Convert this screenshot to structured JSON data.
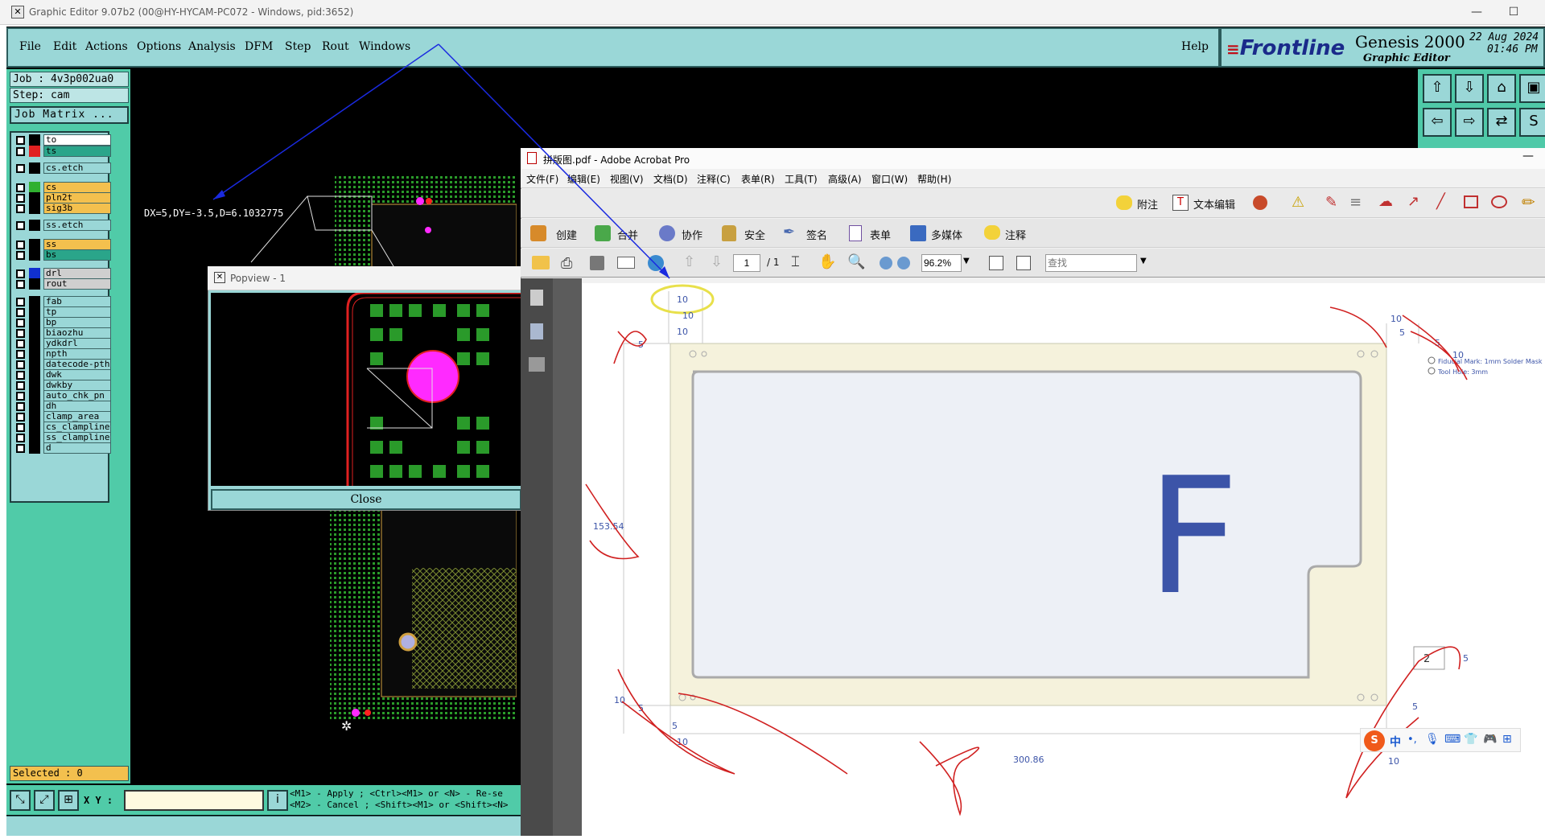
{
  "window": {
    "title": "Graphic Editor 9.07b2 (00@HY-HYCAM-PC072 - Windows, pid:3652)",
    "controls": [
      "minimize",
      "maximize",
      "close"
    ]
  },
  "genesis": {
    "menu": [
      "File",
      "Edit",
      "Actions",
      "Options",
      "Analysis",
      "DFM",
      "Step",
      "Rout",
      "Windows"
    ],
    "help": "Help",
    "brand": {
      "logo": "Frontline",
      "product": "Genesis 2000",
      "subtitle": "Graphic Editor",
      "date": "22 Aug 2024",
      "time": "01:46 PM"
    },
    "job": "Job : 4v3p002ua0",
    "step": "Step: cam",
    "job_matrix": "Job Matrix ...",
    "layers": [
      {
        "name": "to",
        "color": "#000000",
        "bg": "#ffffff"
      },
      {
        "name": "ts",
        "color": "#e02020",
        "bg": "#2aa58a"
      },
      {
        "name": "cs.etch",
        "color": "#000000",
        "bg": "#9ad7d7"
      },
      {
        "name": "cs",
        "color": "#30b030",
        "bg": "#f3c04e"
      },
      {
        "name": "pln2t",
        "color": "#000000",
        "bg": "#f3c04e"
      },
      {
        "name": "sig3b",
        "color": "#000000",
        "bg": "#f3c04e"
      },
      {
        "name": "ss.etch",
        "color": "#000000",
        "bg": "#9ad7d7"
      },
      {
        "name": "ss",
        "color": "#000000",
        "bg": "#f3c04e"
      },
      {
        "name": "bs",
        "color": "#000000",
        "bg": "#2aa58a"
      },
      {
        "name": "drl",
        "color": "#1030d0",
        "bg": "#cfcfcf"
      },
      {
        "name": "rout",
        "color": "#000000",
        "bg": "#cfcfcf"
      },
      {
        "name": "fab",
        "color": "#000000",
        "bg": "#9ad7d7"
      },
      {
        "name": "tp",
        "color": "#000000",
        "bg": "#9ad7d7"
      },
      {
        "name": "bp",
        "color": "#000000",
        "bg": "#9ad7d7"
      },
      {
        "name": "biaozhu",
        "color": "#000000",
        "bg": "#9ad7d7"
      },
      {
        "name": "ydkdrl",
        "color": "#000000",
        "bg": "#9ad7d7"
      },
      {
        "name": "npth",
        "color": "#000000",
        "bg": "#9ad7d7"
      },
      {
        "name": "datecode-pth",
        "color": "#000000",
        "bg": "#9ad7d7"
      },
      {
        "name": "dwk",
        "color": "#000000",
        "bg": "#9ad7d7"
      },
      {
        "name": "dwkby",
        "color": "#000000",
        "bg": "#9ad7d7"
      },
      {
        "name": "auto_chk_pn",
        "color": "#000000",
        "bg": "#9ad7d7"
      },
      {
        "name": "dh",
        "color": "#000000",
        "bg": "#9ad7d7"
      },
      {
        "name": "clamp_area",
        "color": "#000000",
        "bg": "#9ad7d7"
      },
      {
        "name": "cs_clampline",
        "color": "#000000",
        "bg": "#9ad7d7"
      },
      {
        "name": "ss_clampline",
        "color": "#000000",
        "bg": "#9ad7d7"
      },
      {
        "name": "d",
        "color": "#000000",
        "bg": "#9ad7d7"
      }
    ],
    "measure": "DX=5,DY=-3.5,D=6.1032775",
    "popview": {
      "title": "Popview - 1",
      "close": "Close"
    },
    "selected": "Selected : 0",
    "xy_label": "X Y :",
    "xy_value": "",
    "hint1": "<M1> - Apply  ; <Ctrl><M1> or <N> - Re-se",
    "hint2": "<M2> - Cancel ; <Shift><M1> or <Shift><N>"
  },
  "acrobat": {
    "title": "拼版图.pdf - Adobe Acrobat Pro",
    "menu": [
      "文件(F)",
      "编辑(E)",
      "视图(V)",
      "文档(D)",
      "注释(C)",
      "表单(R)",
      "工具(T)",
      "高级(A)",
      "窗口(W)",
      "帮助(H)"
    ],
    "note": "附注",
    "text_edit": "文本编辑",
    "tasks": [
      "创建",
      "合并",
      "协作",
      "安全",
      "签名",
      "表单",
      "多媒体",
      "注释"
    ],
    "page_current": "1",
    "page_total": "/ 1",
    "zoom": "96.2%",
    "search_placeholder": "查找"
  },
  "drawing": {
    "dims": {
      "top_10a": "10",
      "top_10b": "10",
      "top_10c": "10",
      "left_5": "5",
      "right_10": "10",
      "right_5a": "5",
      "right_5b": "5",
      "right_10b": "10",
      "height": "153.54",
      "width": "300.86",
      "bl_10": "10",
      "bl_5": "5",
      "bl_5b": "5",
      "bl_10b": "10",
      "br_5": "5",
      "br_10": "10",
      "detail_2": "2",
      "detail_5": "5"
    },
    "legend": {
      "fiducial": "Fiducial Mark: 1mm  Solder Mask",
      "tool": "Tool Hole: 3mm"
    },
    "letter": "F"
  },
  "ime": {
    "logo": "S",
    "lang": "中"
  }
}
